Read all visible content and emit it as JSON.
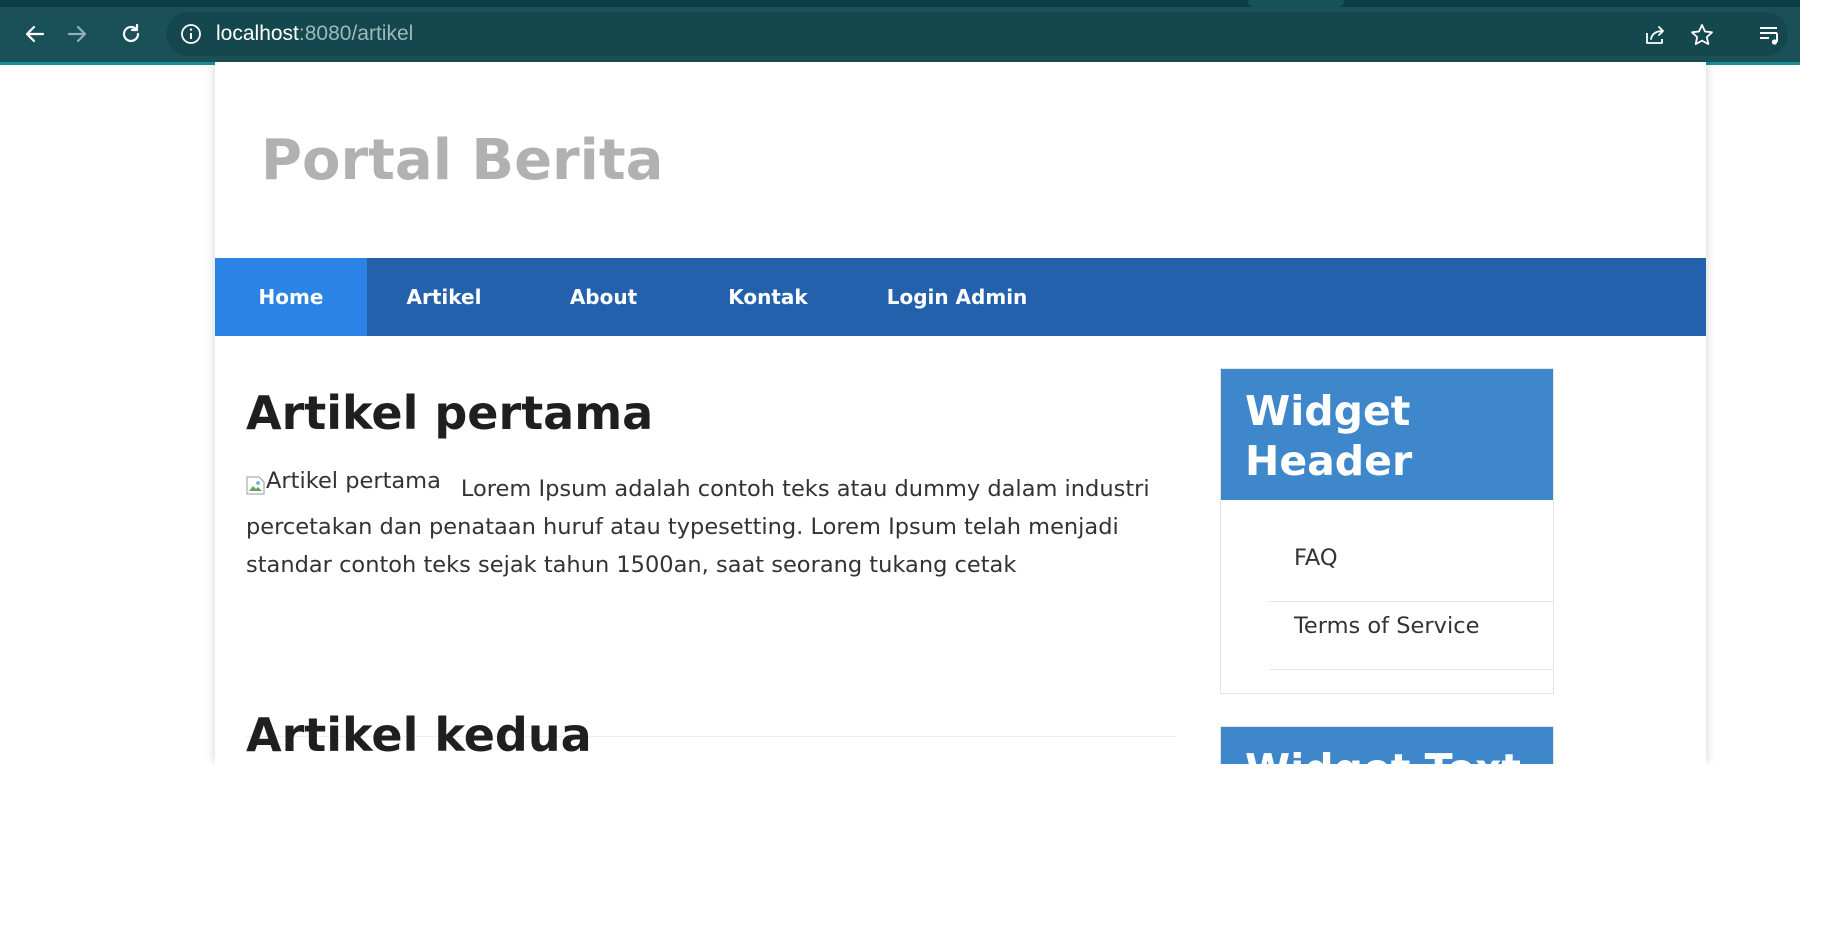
{
  "browser": {
    "url_host": "localhost",
    "url_rest": ":8080/artikel",
    "icons": [
      "back-arrow-icon",
      "forward-arrow-icon",
      "reload-icon",
      "info-icon",
      "share-icon",
      "star-icon",
      "reading-list-icon"
    ]
  },
  "site": {
    "title": "Portal Berita"
  },
  "nav": {
    "items": [
      {
        "label": "Home",
        "active": true
      },
      {
        "label": "Artikel",
        "active": false
      },
      {
        "label": "About",
        "active": false
      },
      {
        "label": "Kontak",
        "active": false
      },
      {
        "label": "Login Admin",
        "active": false
      }
    ]
  },
  "articles": [
    {
      "title": "Artikel pertama",
      "image_alt": "Artikel pertama",
      "body": "Lorem Ipsum adalah contoh teks atau dummy dalam industri percetakan dan penataan huruf atau typesetting. Lorem Ipsum telah menjadi standar contoh teks sejak tahun 1500an, saat seorang tukang cetak"
    },
    {
      "title": "Artikel kedua"
    }
  ],
  "sidebar": {
    "widgets": [
      {
        "header": "Widget Header",
        "links": [
          "FAQ",
          "Terms of Service"
        ]
      },
      {
        "header": "Widget Text"
      }
    ]
  },
  "colors": {
    "browser_toolbar": "#1a5158",
    "navbar": "#2361ad",
    "nav_active": "#2c83e6",
    "widget_header": "#3e87cb",
    "site_title": "#b1b1b1"
  }
}
